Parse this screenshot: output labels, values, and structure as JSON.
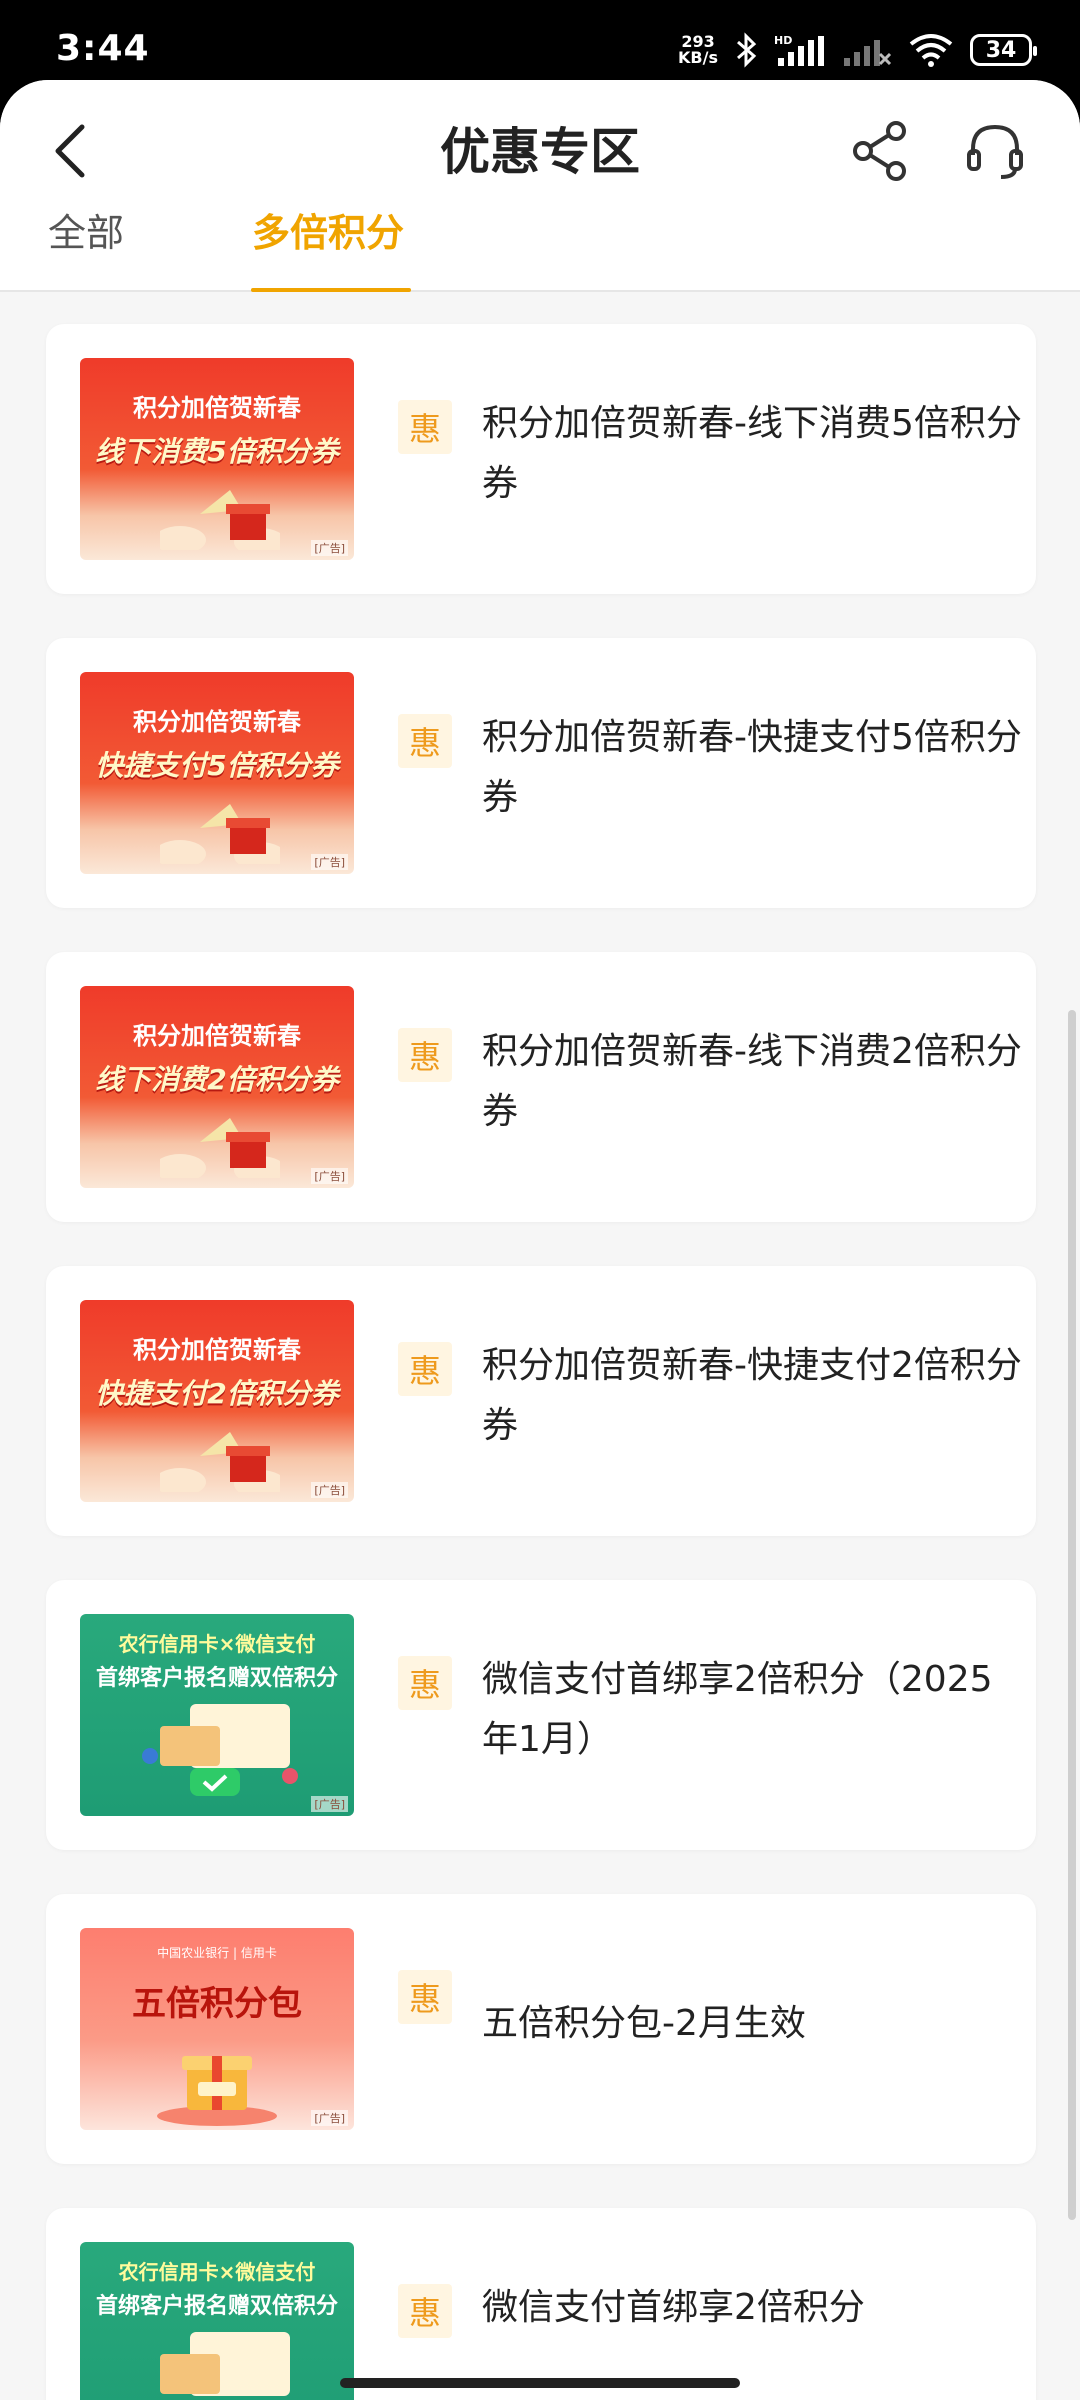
{
  "status_bar": {
    "time": "3:44",
    "net_speed_value": "293",
    "net_speed_unit": "KB/s",
    "battery": "34"
  },
  "header": {
    "title": "优惠专区"
  },
  "tabs": [
    {
      "label": "全部"
    },
    {
      "label": "多倍积分"
    }
  ],
  "active_tab": "多倍积分",
  "accent_color": "#f0a400",
  "badge_label": "惠",
  "ad_tag": "[广告]",
  "promos": [
    {
      "title": "积分加倍贺新春-线下消费5倍积分券",
      "banner_line1": "积分加倍贺新春",
      "banner_line2": "线下消费5倍积分券",
      "theme": "red"
    },
    {
      "title": "积分加倍贺新春-快捷支付5倍积分券",
      "banner_line1": "积分加倍贺新春",
      "banner_line2": "快捷支付5倍积分券",
      "theme": "red"
    },
    {
      "title": "积分加倍贺新春-线下消费2倍积分券",
      "banner_line1": "积分加倍贺新春",
      "banner_line2": "线下消费2倍积分券",
      "theme": "red"
    },
    {
      "title": "积分加倍贺新春-快捷支付2倍积分券",
      "banner_line1": "积分加倍贺新春",
      "banner_line2": "快捷支付2倍积分券",
      "theme": "red"
    },
    {
      "title": "微信支付首绑享2倍积分（2025年1月）",
      "banner_line1": "农行信用卡×微信支付",
      "banner_line2": "首绑客户报名赠双倍积分",
      "theme": "green"
    },
    {
      "title": "五倍积分包-2月生效",
      "banner_line1": "中国农业银行 | 信用卡",
      "banner_line2": "五倍积分包",
      "theme": "pink"
    },
    {
      "title": "微信支付首绑享2倍积分",
      "banner_line1": "农行信用卡×微信支付",
      "banner_line2": "首绑客户报名赠双倍积分",
      "theme": "green"
    }
  ]
}
